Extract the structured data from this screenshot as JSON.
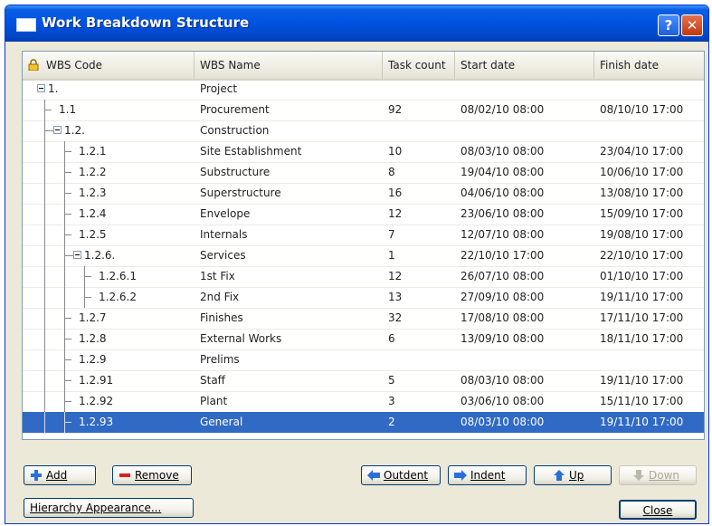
{
  "window": {
    "title": "Work Breakdown Structure",
    "help_label": "?",
    "close_label": "✕"
  },
  "columns": [
    "WBS Code",
    "WBS Name",
    "Task count",
    "Start date",
    "Finish date"
  ],
  "rows": [
    {
      "code": "1.",
      "name": "Project",
      "count": "",
      "start": "",
      "finish": ""
    },
    {
      "code": "1.1",
      "name": "Procurement",
      "count": "92",
      "start": "08/02/10 08:00",
      "finish": "08/10/10 17:00"
    },
    {
      "code": "1.2.",
      "name": "Construction",
      "count": "",
      "start": "",
      "finish": ""
    },
    {
      "code": "1.2.1",
      "name": "Site Establishment",
      "count": "10",
      "start": "08/03/10 08:00",
      "finish": "23/04/10 17:00"
    },
    {
      "code": "1.2.2",
      "name": "Substructure",
      "count": "8",
      "start": "19/04/10 08:00",
      "finish": "10/06/10 17:00"
    },
    {
      "code": "1.2.3",
      "name": "Superstructure",
      "count": "16",
      "start": "04/06/10 08:00",
      "finish": "13/08/10 17:00"
    },
    {
      "code": "1.2.4",
      "name": "Envelope",
      "count": "12",
      "start": "23/06/10 08:00",
      "finish": "15/09/10 17:00"
    },
    {
      "code": "1.2.5",
      "name": "Internals",
      "count": "7",
      "start": "12/07/10 08:00",
      "finish": "19/08/10 17:00"
    },
    {
      "code": "1.2.6.",
      "name": "Services",
      "count": "1",
      "start": "22/10/10 17:00",
      "finish": "22/10/10 17:00"
    },
    {
      "code": "1.2.6.1",
      "name": "1st Fix",
      "count": "12",
      "start": "26/07/10 08:00",
      "finish": "01/10/10 17:00"
    },
    {
      "code": "1.2.6.2",
      "name": "2nd Fix",
      "count": "13",
      "start": "27/09/10 08:00",
      "finish": "19/11/10 17:00"
    },
    {
      "code": "1.2.7",
      "name": "Finishes",
      "count": "32",
      "start": "17/08/10 08:00",
      "finish": "17/11/10 17:00"
    },
    {
      "code": "1.2.8",
      "name": "External Works",
      "count": "6",
      "start": "13/09/10 08:00",
      "finish": "18/11/10 17:00"
    },
    {
      "code": "1.2.9",
      "name": "Prelims",
      "count": "",
      "start": "",
      "finish": ""
    },
    {
      "code": "1.2.91",
      "name": "Staff",
      "count": "5",
      "start": "08/03/10 08:00",
      "finish": "19/11/10 17:00"
    },
    {
      "code": "1.2.92",
      "name": "Plant",
      "count": "3",
      "start": "03/06/10 08:00",
      "finish": "15/11/10 17:00"
    },
    {
      "code": "1.2.93",
      "name": "General",
      "count": "2",
      "start": "08/03/10 08:00",
      "finish": "19/11/10 17:00",
      "selected": true
    }
  ],
  "buttons": {
    "add": "Add",
    "remove": "Remove",
    "outdent": "Outdent",
    "indent": "Indent",
    "up": "Up",
    "down": "Down",
    "hierarchy": "Hierarchy Appearance...",
    "close": "Close"
  },
  "colors": {
    "selection": "#316ac5",
    "titlebar": "#0055e5"
  }
}
